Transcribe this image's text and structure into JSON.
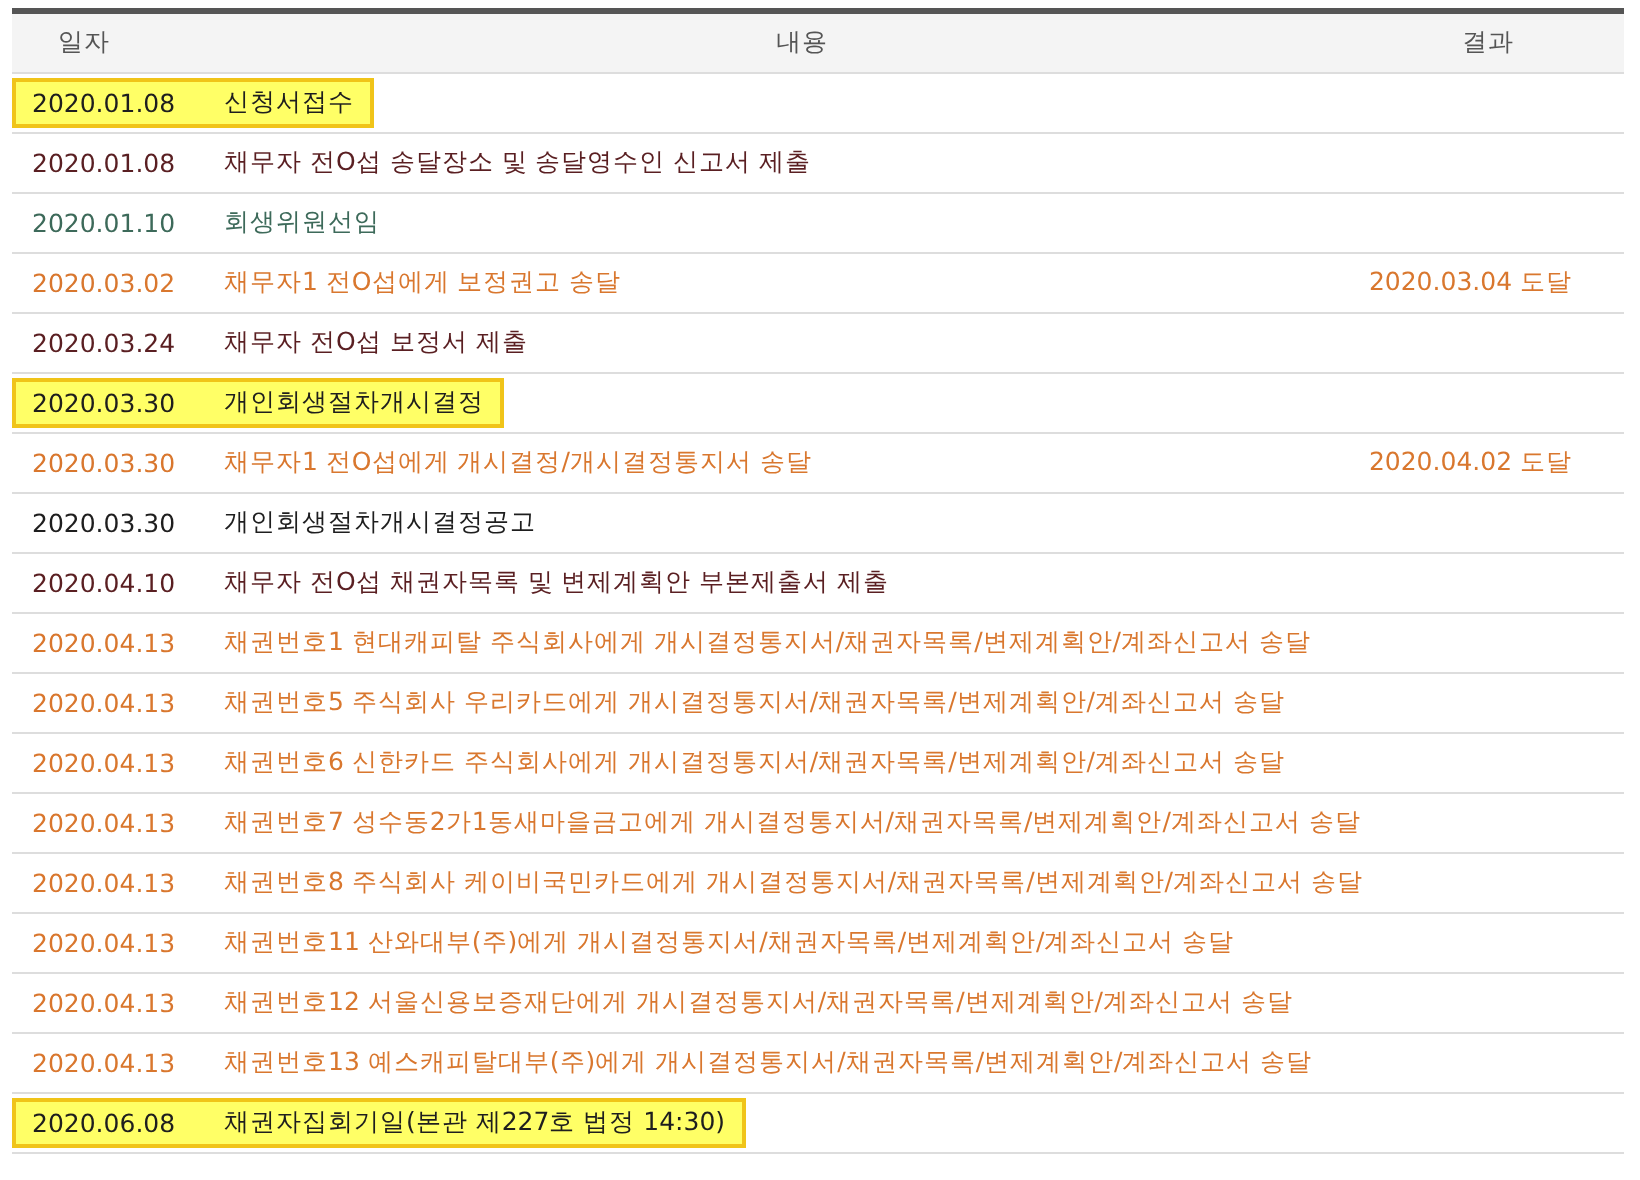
{
  "table": {
    "columns": [
      "일자",
      "내용",
      "결과"
    ],
    "rows": [
      {
        "date": "2020.01.08",
        "content": "신청서접수",
        "kind": "court",
        "highlighted": true
      },
      {
        "date": "2020.01.08",
        "content": "채무자 전O섭 송달장소 및 송달영수인 신고서 제출",
        "kind": "debtor",
        "highlighted": false
      },
      {
        "date": "2020.01.10",
        "content": "회생위원선임",
        "kind": "committee",
        "highlighted": false
      },
      {
        "date": "2020.03.02",
        "content": "채무자1 전O섭에게 보정권고 송달",
        "result": "2020.03.04 도달",
        "kind": "delivery",
        "highlighted": false
      },
      {
        "date": "2020.03.24",
        "content": "채무자 전O섭 보정서 제출",
        "kind": "debtor",
        "highlighted": false
      },
      {
        "date": "2020.03.30",
        "content": "개인회생절차개시결정",
        "kind": "court",
        "highlighted": true
      },
      {
        "date": "2020.03.30",
        "content": "채무자1 전O섭에게 개시결정/개시결정통지서 송달",
        "result": "2020.04.02 도달",
        "kind": "delivery",
        "highlighted": false
      },
      {
        "date": "2020.03.30",
        "content": "개인회생절차개시결정공고",
        "kind": "court",
        "highlighted": false
      },
      {
        "date": "2020.04.10",
        "content": "채무자 전O섭 채권자목록 및 변제계획안 부본제출서 제출",
        "kind": "debtor",
        "highlighted": false
      },
      {
        "date": "2020.04.13",
        "content": "채권번호1 현대캐피탈 주식회사에게 개시결정통지서/채권자목록/변제계획안/계좌신고서 송달",
        "kind": "delivery",
        "highlighted": false
      },
      {
        "date": "2020.04.13",
        "content": "채권번호5 주식회사 우리카드에게 개시결정통지서/채권자목록/변제계획안/계좌신고서 송달",
        "kind": "delivery",
        "highlighted": false
      },
      {
        "date": "2020.04.13",
        "content": "채권번호6 신한카드 주식회사에게 개시결정통지서/채권자목록/변제계획안/계좌신고서 송달",
        "kind": "delivery",
        "highlighted": false
      },
      {
        "date": "2020.04.13",
        "content": "채권번호7 성수동2가1동새마을금고에게 개시결정통지서/채권자목록/변제계획안/계좌신고서 송달",
        "kind": "delivery",
        "highlighted": false
      },
      {
        "date": "2020.04.13",
        "content": "채권번호8 주식회사 케이비국민카드에게 개시결정통지서/채권자목록/변제계획안/계좌신고서 송달",
        "kind": "delivery",
        "highlighted": false
      },
      {
        "date": "2020.04.13",
        "content": "채권번호11 산와대부(주)에게 개시결정통지서/채권자목록/변제계획안/계좌신고서 송달",
        "kind": "delivery",
        "highlighted": false
      },
      {
        "date": "2020.04.13",
        "content": "채권번호12 서울신용보증재단에게 개시결정통지서/채권자목록/변제계획안/계좌신고서 송달",
        "kind": "delivery",
        "highlighted": false
      },
      {
        "date": "2020.04.13",
        "content": "채권번호13 예스캐피탈대부(주)에게 개시결정통지서/채권자목록/변제계획안/계좌신고서 송달",
        "kind": "delivery",
        "highlighted": false
      },
      {
        "date": "2020.06.08",
        "content": "채권자집회기일(본관 제227호 법정 14:30)",
        "kind": "court",
        "highlighted": true
      }
    ]
  }
}
